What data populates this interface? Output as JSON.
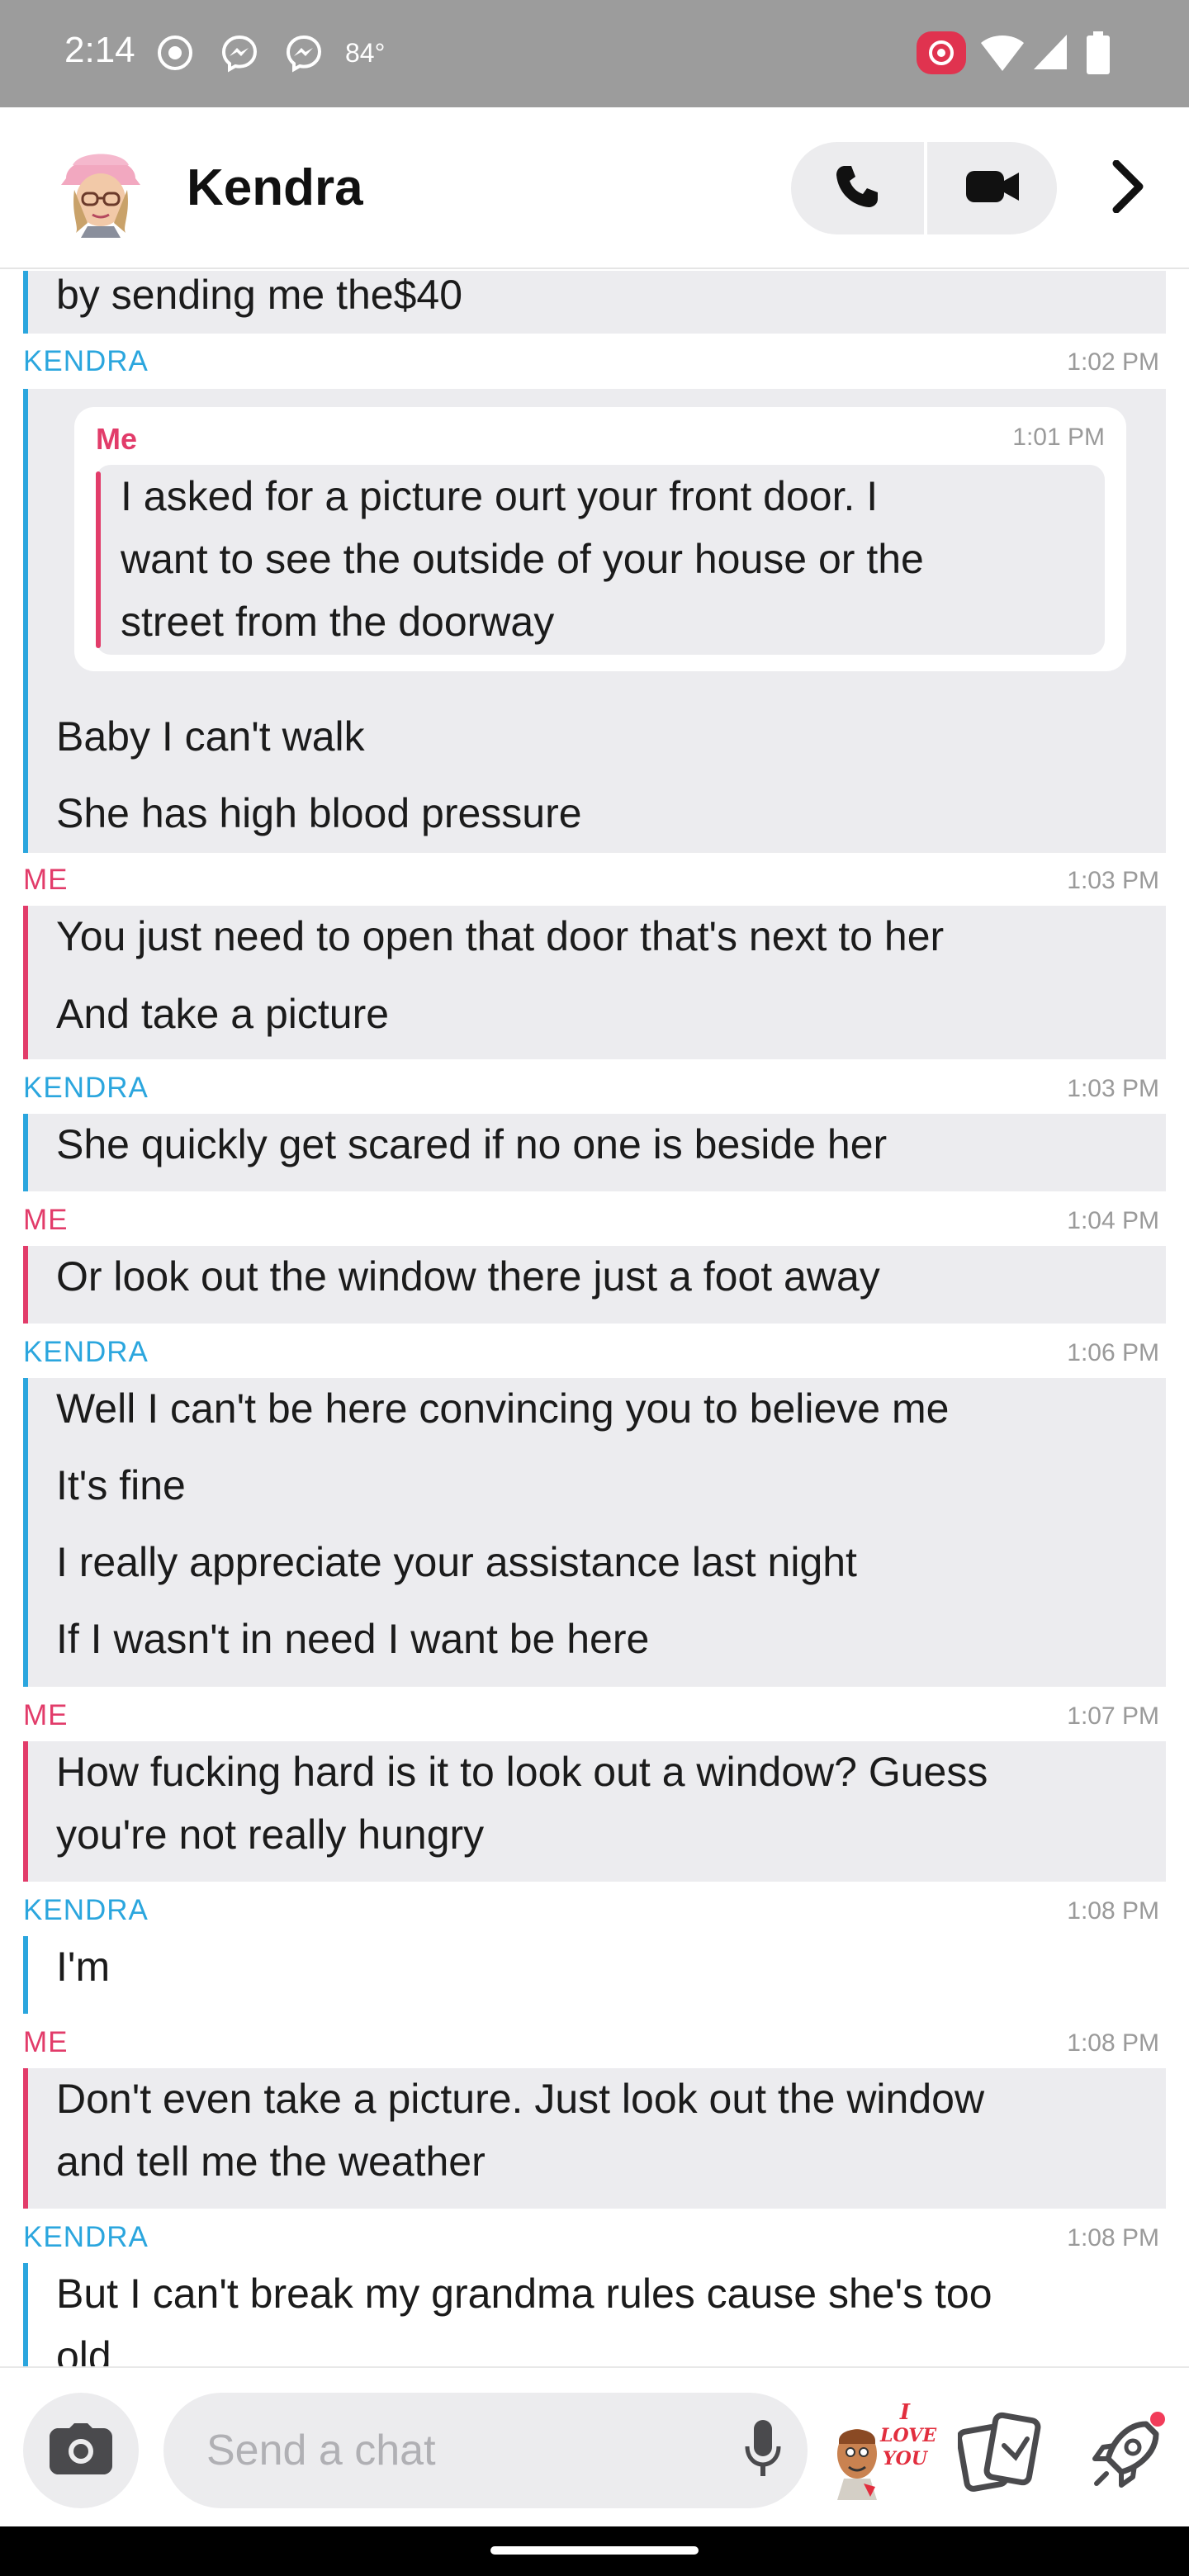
{
  "status_bar": {
    "time": "2:14",
    "temperature": "84°",
    "icons": [
      "screen-record-icon",
      "messenger-icon",
      "messenger-icon",
      "cast-icon",
      "wifi-icon",
      "signal-icon",
      "battery-icon"
    ]
  },
  "header": {
    "contact_name": "Kendra",
    "icons": [
      "avatar",
      "phone-icon",
      "video-camera-icon",
      "chevron-right-icon"
    ]
  },
  "colors": {
    "kendra": "#2ba6de",
    "me": "#e23c6a",
    "bubble_bg": "#ececef",
    "timestamp": "#9a9a9a"
  },
  "chat": {
    "partial_top": {
      "text": "by sending me the$40"
    },
    "groups": [
      {
        "sender": "KENDRA",
        "time": "1:02 PM",
        "quote": {
          "sender": "Me",
          "time": "1:01 PM",
          "lines": [
            "I asked for a picture ourt your front door. I",
            "want to see the outside of your house or the",
            "street from the doorway"
          ]
        },
        "messages": [
          "Baby I can't walk",
          "She has high blood pressure"
        ]
      },
      {
        "sender": "ME",
        "time": "1:03 PM",
        "messages": [
          "You just need to open that door that's next to her",
          "And take a picture"
        ]
      },
      {
        "sender": "KENDRA",
        "time": "1:03 PM",
        "messages": [
          "She quickly get scared if no one is beside her"
        ]
      },
      {
        "sender": "ME",
        "time": "1:04 PM",
        "messages": [
          "Or look out the window there just a foot away"
        ]
      },
      {
        "sender": "KENDRA",
        "time": "1:06 PM",
        "messages": [
          "Well I can't be here convincing you to believe me",
          "It's fine",
          "I really appreciate your assistance last night",
          "If I wasn't in need I want be here"
        ]
      },
      {
        "sender": "ME",
        "time": "1:07 PM",
        "messages": [
          "How fucking hard is it to look out a window? Guess",
          "you're not really hungry"
        ]
      },
      {
        "sender": "KENDRA",
        "time": "1:08 PM",
        "messages": [
          "I'm"
        ]
      },
      {
        "sender": "ME",
        "time": "1:08 PM",
        "messages": [
          "Don't even take a picture. Just look out the window",
          "and tell me the weather"
        ]
      },
      {
        "sender": "KENDRA",
        "time": "1:08 PM",
        "messages": [
          "But I can't break my grandma rules cause she's too",
          "old"
        ]
      }
    ]
  },
  "input_bar": {
    "placeholder": "Send a chat",
    "value": "",
    "sticker_text": [
      "I",
      "LOVE",
      "YOU"
    ],
    "icons": [
      "camera-icon",
      "microphone-icon",
      "bitmoji-sticker-icon",
      "cards-icon",
      "rocket-icon"
    ]
  }
}
